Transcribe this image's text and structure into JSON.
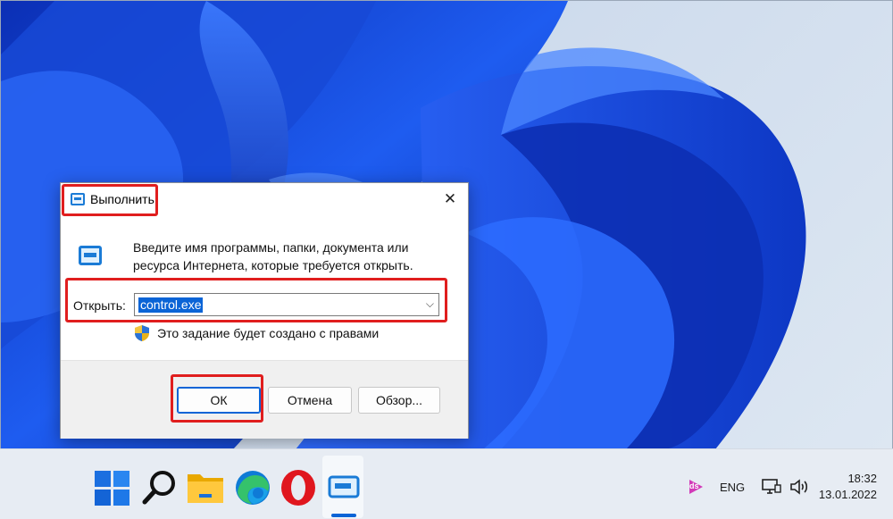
{
  "dialog": {
    "title": "Выполнить",
    "close_glyph": "✕",
    "description": "Введите имя программы, папки, документа или ресурса Интернета, которые требуется открыть.",
    "open_label": "Открыть:",
    "input_value": "control.exe",
    "dropdown_glyph": "⌵",
    "admin_note": "Это задание будет создано с правами",
    "ok_label": "ОК",
    "cancel_label": "Отмена",
    "browse_label": "Обзор..."
  },
  "taskbar": {
    "icons": [
      "windows-start-icon",
      "search-icon",
      "file-explorer-icon",
      "edge-icon",
      "opera-icon",
      "run-app-icon"
    ],
    "tray": {
      "ds_label": "ds",
      "language": "ENG",
      "time": "18:32",
      "date": "13.01.2022"
    }
  },
  "colors": {
    "accent": "#0a64d6",
    "highlight": "#e01e1e"
  }
}
